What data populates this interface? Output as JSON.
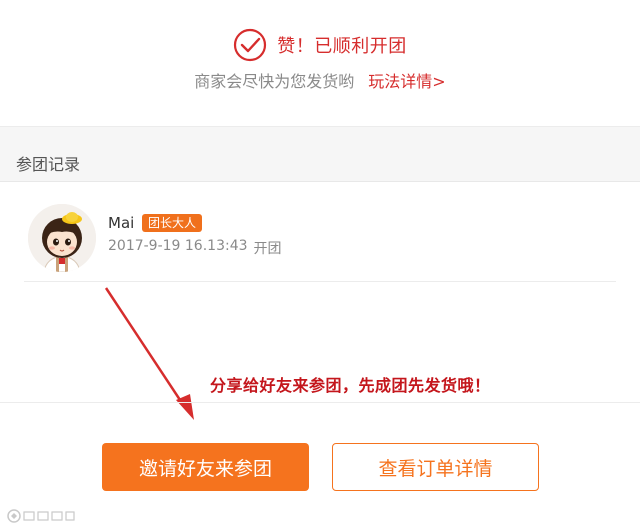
{
  "success": {
    "icon": "check-circle-icon",
    "title": "赞！已顺利开团",
    "subtitle": "商家会尽快为您发货哟",
    "rules_link": "玩法详情>",
    "accent_color": "#d62d2d"
  },
  "records": {
    "section_title": "参团记录",
    "items": [
      {
        "name": "Mai",
        "badge": "团长大人",
        "time": "2017-9-19 16.13:43",
        "action": "开团",
        "avatar": "cartoon-girl-avatar"
      }
    ]
  },
  "annotation": {
    "text": "分享给好友来参团，先成团先发货哦！",
    "color": "#c4161c"
  },
  "actions": {
    "invite_label": "邀请好友来参团",
    "detail_label": "查看订单详情",
    "primary_color": "#f5731e"
  },
  "watermark": {
    "text": "大凯实操"
  }
}
